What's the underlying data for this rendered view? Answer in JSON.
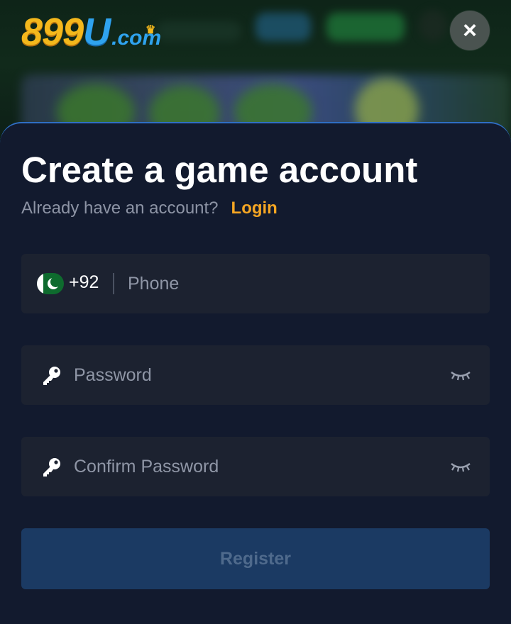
{
  "brand": {
    "logo_main": "899",
    "logo_u": "U",
    "logo_suffix": ".com"
  },
  "header": {
    "close_icon": "×"
  },
  "modal": {
    "title": "Create a game account",
    "subtitle": "Already have an account?",
    "login_link": "Login"
  },
  "form": {
    "phone": {
      "country_flag": "pakistan-flag-icon",
      "country_code": "+92",
      "placeholder": "Phone",
      "value": ""
    },
    "password": {
      "placeholder": "Password",
      "value": "",
      "icon": "key-icon",
      "toggle_icon": "eye-closed-icon"
    },
    "confirm_password": {
      "placeholder": "Confirm Password",
      "value": "",
      "icon": "key-icon",
      "toggle_icon": "eye-closed-icon"
    },
    "register_label": "Register"
  },
  "colors": {
    "accent_link": "#f5a623",
    "modal_bg": "#121a2e",
    "field_bg": "#1c2230",
    "button_disabled_bg": "#1b3a63",
    "modal_border": "#2f6ec4"
  }
}
